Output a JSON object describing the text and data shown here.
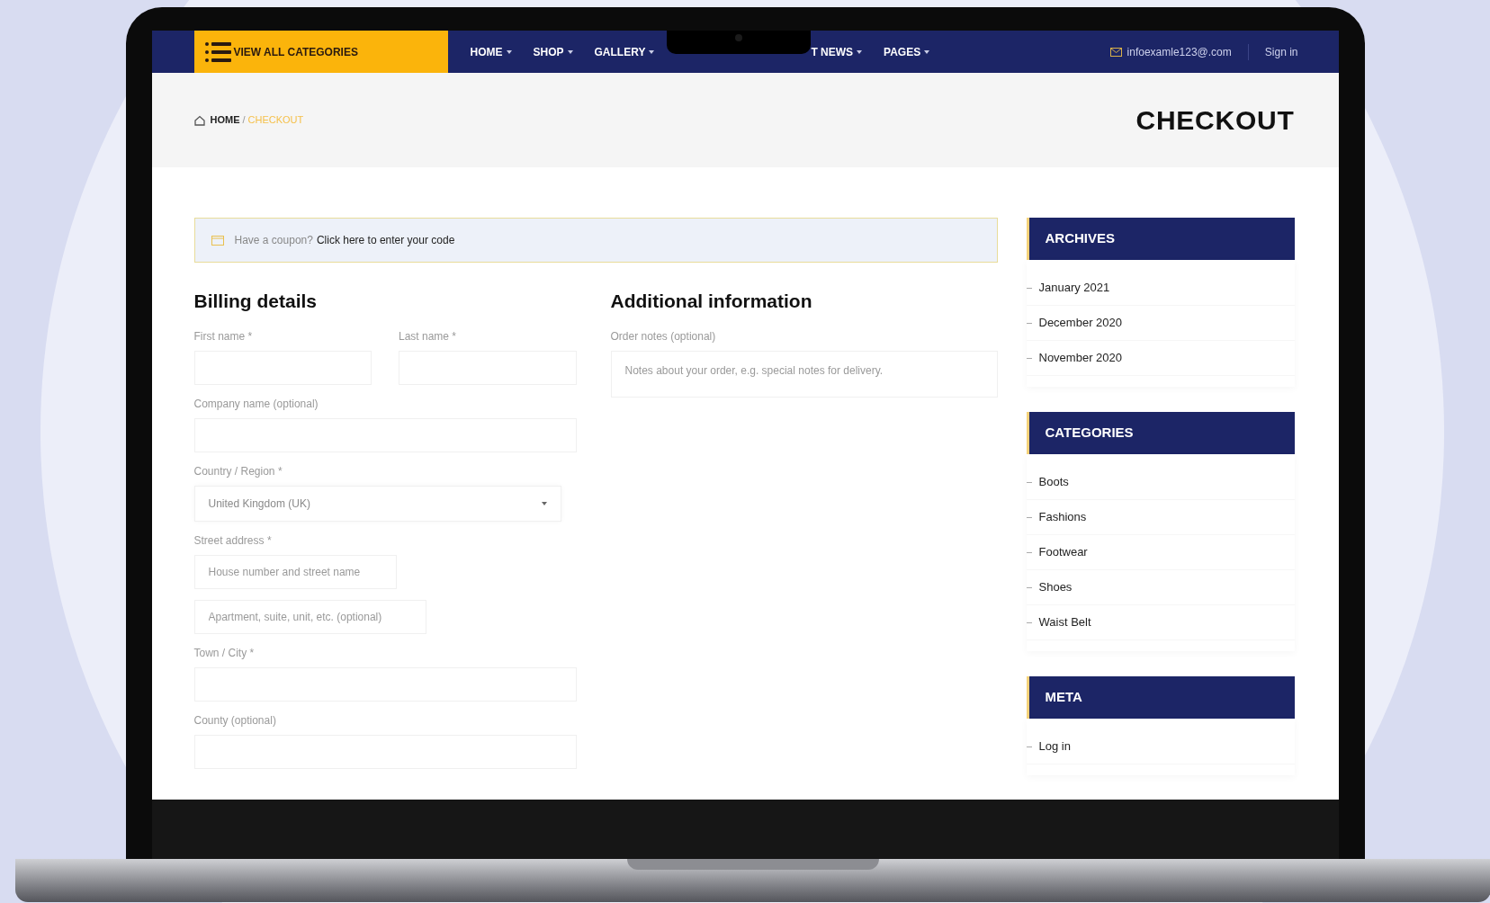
{
  "nav": {
    "menu_label": "VIEW ALL CATEGORIES",
    "items": [
      {
        "label": "HOME"
      },
      {
        "label": "SHOP"
      },
      {
        "label": "GALLERY"
      }
    ],
    "items_after_notch": [
      {
        "label": "T NEWS"
      },
      {
        "label": "PAGES"
      }
    ],
    "email": "infoexamle123@.com",
    "sign_in": "Sign in"
  },
  "breadcrumb": [
    {
      "label": "HOME",
      "selected": false
    },
    {
      "label": "CHECKOUT",
      "selected": true
    }
  ],
  "breadcrumb_separator": "/",
  "page_title": "CHECKOUT",
  "coupon": {
    "text": "Have a coupon?",
    "link": "Click here to enter your code"
  },
  "billing": {
    "title": "Billing details",
    "rows": [
      {
        "fields": [
          {
            "kind": "input",
            "label": "First name *"
          },
          {
            "kind": "input",
            "label": "Last name *"
          }
        ]
      },
      {
        "fields": [
          {
            "kind": "input",
            "label": "Company name (optional)"
          }
        ]
      },
      {
        "fields": [
          {
            "kind": "select",
            "label": "Country / Region *",
            "value": "United Kingdom (UK)"
          }
        ]
      },
      {
        "fields": [
          {
            "kind": "input",
            "label": "Street address *",
            "placeholder": "House number and street name"
          }
        ]
      },
      {
        "fields": [
          {
            "kind": "input",
            "placeholder": "Apartment, suite, unit, etc. (optional)"
          }
        ]
      },
      {
        "fields": [
          {
            "kind": "input",
            "label": "Town / City *"
          }
        ]
      },
      {
        "fields": [
          {
            "kind": "input",
            "label": "County (optional)"
          }
        ]
      }
    ]
  },
  "additional": {
    "title": "Additional information",
    "label": "Order notes (optional)",
    "placeholder": "Notes about your order, e.g. special notes for delivery."
  },
  "sidebar": [
    {
      "title": "ARCHIVES",
      "items": [
        "January 2021",
        "December 2020",
        "November 2020"
      ]
    },
    {
      "title": "CATEGORIES",
      "items": [
        "Boots",
        "Fashions",
        "Footwear",
        "Shoes",
        "Waist Belt"
      ]
    },
    {
      "title": "META",
      "items": [
        "Log in"
      ]
    }
  ]
}
